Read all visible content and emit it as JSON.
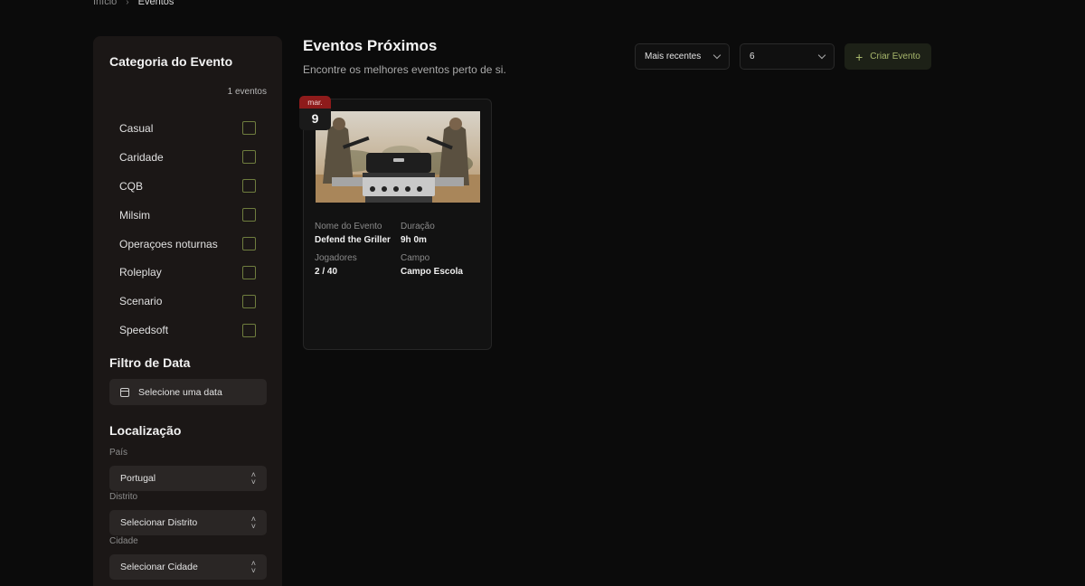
{
  "breadcrumb": {
    "home": "Início",
    "separator": "›",
    "current": "Eventos"
  },
  "sidebar": {
    "category_title": "Categoria do Evento",
    "event_count": "1 eventos",
    "categories": [
      {
        "label": "Casual",
        "checked": false
      },
      {
        "label": "Caridade",
        "checked": false
      },
      {
        "label": "CQB",
        "checked": false
      },
      {
        "label": "Milsim",
        "checked": false
      },
      {
        "label": "Operaçoes noturnas",
        "checked": false
      },
      {
        "label": "Roleplay",
        "checked": false
      },
      {
        "label": "Scenario",
        "checked": false
      },
      {
        "label": "Speedsoft",
        "checked": false
      }
    ],
    "date_filter_title": "Filtro de Data",
    "date_placeholder": "Selecione uma data",
    "location_title": "Localização",
    "country_label": "País",
    "country_value": "Portugal",
    "district_label": "Distrito",
    "district_value": "Selecionar Distrito",
    "city_label": "Cidade",
    "city_value": "Selecionar Cidade"
  },
  "header": {
    "title": "Eventos Próximos",
    "subtitle": "Encontre os melhores eventos perto de si.",
    "sort_value": "Mais recentes",
    "per_page_value": "6",
    "create_label": "Criar Evento"
  },
  "event": {
    "month": "mar.",
    "day": "9",
    "name_label": "Nome do Evento",
    "name": "Defend the Griller",
    "duration_label": "Duração",
    "duration": "9h 0m",
    "players_label": "Jogadores",
    "players": "2 / 40",
    "field_label": "Campo",
    "field": "Campo Escola"
  },
  "colors": {
    "accent_green": "#a8b86c",
    "checkbox_border": "#6f7d3e",
    "badge_red": "#8e1b1b",
    "sidebar_bg": "#1b1716",
    "page_bg": "#0b0b0b"
  },
  "icons": [
    "chevron-right-icon",
    "calendar-icon",
    "updown-icon",
    "chevron-down-icon",
    "plus-icon"
  ]
}
